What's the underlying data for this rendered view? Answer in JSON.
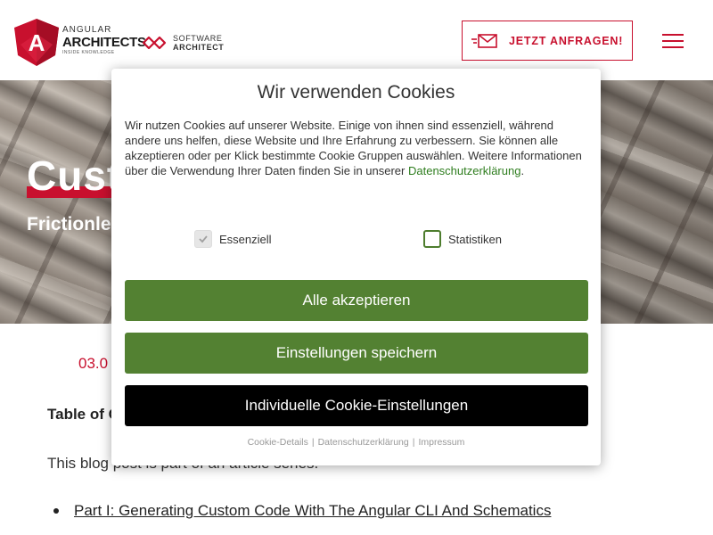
{
  "header": {
    "brand_small": "ANGULAR",
    "brand_big": "ARCHITECTS",
    "brand_tag": "INSIDE KNOWLEDGE",
    "partner_line1": "SOFTWARE",
    "partner_line2": "ARCHITECT",
    "cta_label": "JETZT ANFRAGEN!",
    "accent_color": "#c8102e"
  },
  "hero": {
    "title": "Cust",
    "subtitle": "Frictionle"
  },
  "content": {
    "date": "03.0",
    "toc_heading": "Table of C",
    "intro": "This blog post is part of an article series.",
    "list_items": [
      "Part I: Generating Custom Code With The Angular CLI And Schematics"
    ]
  },
  "cookie": {
    "title": "Wir verwenden Cookies",
    "text_before_link": "Wir nutzen Cookies auf unserer Website. Einige von ihnen sind essenziell, während andere uns helfen, diese Website und Ihre Erfahrung zu verbessern. Sie können alle akzeptieren oder per Klick bestimmte Cookie Gruppen auswählen. Weitere Informationen über die Verwendung Ihrer Daten finden Sie in unserer ",
    "link_text": "Datenschutzerklärung",
    "text_after_link": ".",
    "checkbox_essential": "Essenziell",
    "checkbox_stats": "Statistiken",
    "btn_accept_all": "Alle akzeptieren",
    "btn_save": "Einstellungen speichern",
    "btn_individual": "Individuelle Cookie-Einstellungen",
    "footer_link1": "Cookie-Details",
    "footer_link2": "Datenschutzerklärung",
    "footer_link3": "Impressum",
    "separator": "|",
    "button_color": "#538132"
  }
}
